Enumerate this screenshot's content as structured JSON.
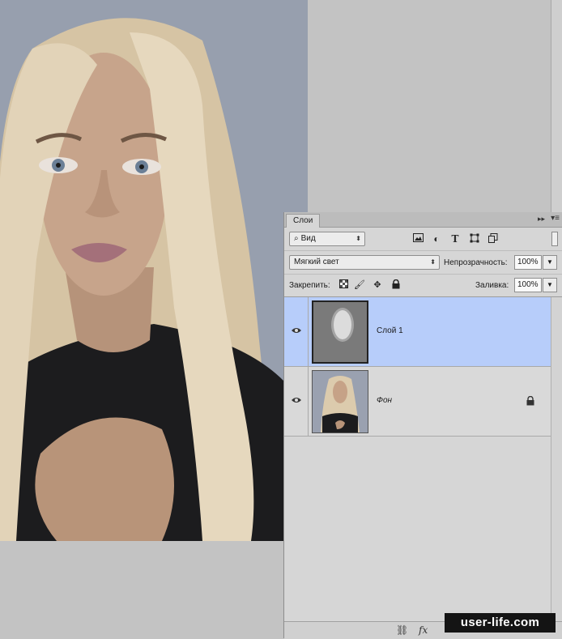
{
  "canvas": {
    "photo_icon": "portrait-photo"
  },
  "panel": {
    "tab_label": "Слои",
    "collapse_icon": "double-chevron-right-icon",
    "menu_icon": "panel-menu-icon",
    "filter": {
      "label": "Вид",
      "icon": "search-icon"
    },
    "filter_icons": [
      "image-filter-icon",
      "adjustment-filter-icon",
      "type-filter-icon",
      "shape-filter-icon",
      "smart-object-filter-icon"
    ],
    "blend_mode": "Мягкий свет",
    "opacity_label": "Непрозрачность:",
    "opacity_value": "100%",
    "lock_label": "Закрепить:",
    "fill_label": "Заливка:",
    "fill_value": "100%"
  },
  "layers": [
    {
      "name": "Слой 1",
      "selected": true,
      "visible": true
    },
    {
      "name": "Фон",
      "selected": false,
      "visible": true,
      "locked": true
    }
  ],
  "colors": {
    "selected_layer": "#b7cdfa",
    "panel_bg": "#d6d6d6",
    "workspace": "#c3c3c3"
  },
  "watermark": "user-life.com"
}
